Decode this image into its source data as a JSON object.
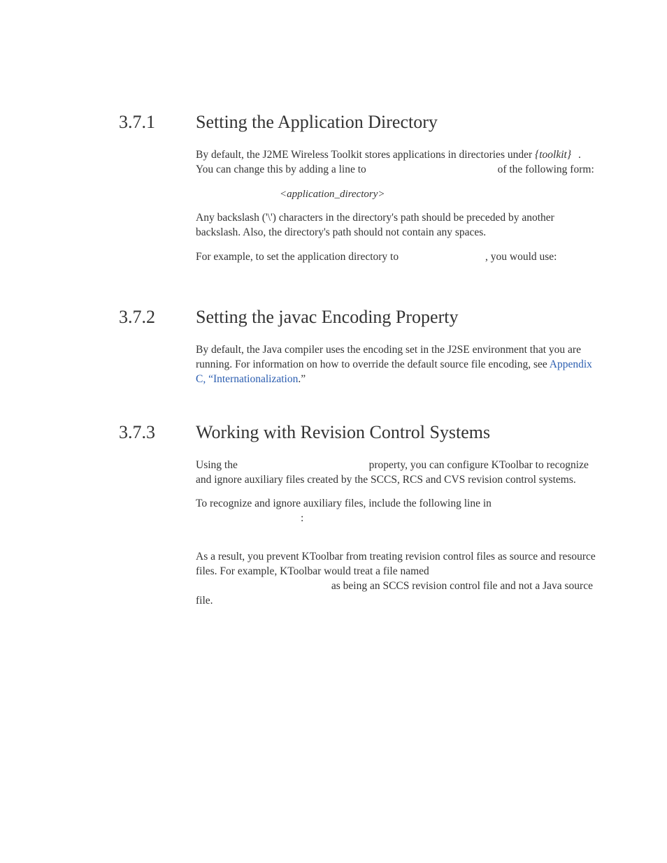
{
  "sections": [
    {
      "number": "3.7.1",
      "title": "Setting the Application Directory",
      "p1a": "By default, the J2ME Wireless Toolkit stores applications in directories under ",
      "toolkit": "{toolkit}",
      "p1b": ". You can change this by adding a line to ",
      "p1c": " of the following form:",
      "code1": "<application_directory>",
      "p2": "Any backslash ('\\') characters in the directory's path should be preceded by another backslash. Also, the directory's path should not contain any spaces.",
      "p3a": "For example, to set the application directory to ",
      "p3b": ", you would use:"
    },
    {
      "number": "3.7.2",
      "title": "Setting the javac Encoding Property",
      "p1a": "By default, the Java compiler uses the encoding set in the J2SE environment that you are running. For information on how to override the default source file encoding, see ",
      "link_label": "Appendix C,  “Internationalization",
      "p1b": ".”"
    },
    {
      "number": "3.7.3",
      "title": "Working with Revision Control Systems",
      "p1a": "Using the ",
      "p1b": " property, you can configure KToolbar to recognize and ignore auxiliary files created by the SCCS, RCS and CVS revision control systems.",
      "p2a": "To recognize and ignore auxiliary files, include the following line in ",
      "p2b": ":",
      "p3": "As a result, you prevent KToolbar from treating revision control files as source and resource files. For example, KToolbar would treat a file named ",
      "p4": " as being an SCCS revision control file and not a Java source file."
    }
  ]
}
